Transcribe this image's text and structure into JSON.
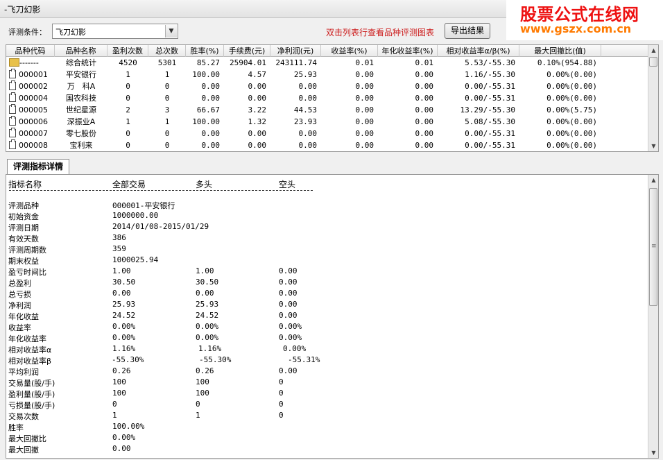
{
  "window": {
    "title": "-飞刀幻影"
  },
  "watermark": {
    "line1": "股票公式在线网",
    "line2": "www.gszx.com.cn"
  },
  "toolbar": {
    "condition_label": "评测条件：",
    "condition_value": "飞刀幻影",
    "hint": "双击列表行查看品种评测图表",
    "export_label": "导出结果"
  },
  "grid": {
    "columns": [
      "品种代码",
      "品种名称",
      "盈利次数",
      "总次数",
      "胜率(%)",
      "手续费(元)",
      "净利润(元)",
      "收益率(%)",
      "年化收益率(%)",
      "相对收益率α/β(%)",
      "最大回撤比(值)"
    ],
    "rows": [
      {
        "code": "-------",
        "name": "综合统计",
        "wins": "4520",
        "total": "5301",
        "winrate": "85.27",
        "fee": "25904.01",
        "profit": "243111.74",
        "ret": "0.01",
        "annual": "0.01",
        "ab": "5.53/-55.30",
        "dd": "0.10%(954.88)",
        "icon": "folder"
      },
      {
        "code": "000001",
        "name": "平安银行",
        "wins": "1",
        "total": "1",
        "winrate": "100.00",
        "fee": "4.57",
        "profit": "25.93",
        "ret": "0.00",
        "annual": "0.00",
        "ab": "1.16/-55.30",
        "dd": "0.00%(0.00)",
        "icon": "file"
      },
      {
        "code": "000002",
        "name": "万　科A",
        "wins": "0",
        "total": "0",
        "winrate": "0.00",
        "fee": "0.00",
        "profit": "0.00",
        "ret": "0.00",
        "annual": "0.00",
        "ab": "0.00/-55.31",
        "dd": "0.00%(0.00)",
        "icon": "file"
      },
      {
        "code": "000004",
        "name": "国农科技",
        "wins": "0",
        "total": "0",
        "winrate": "0.00",
        "fee": "0.00",
        "profit": "0.00",
        "ret": "0.00",
        "annual": "0.00",
        "ab": "0.00/-55.31",
        "dd": "0.00%(0.00)",
        "icon": "file"
      },
      {
        "code": "000005",
        "name": "世纪星源",
        "wins": "2",
        "total": "3",
        "winrate": "66.67",
        "fee": "3.22",
        "profit": "44.53",
        "ret": "0.00",
        "annual": "0.00",
        "ab": "13.29/-55.30",
        "dd": "0.00%(5.75)",
        "icon": "file"
      },
      {
        "code": "000006",
        "name": "深振业A",
        "wins": "1",
        "total": "1",
        "winrate": "100.00",
        "fee": "1.32",
        "profit": "23.93",
        "ret": "0.00",
        "annual": "0.00",
        "ab": "5.08/-55.30",
        "dd": "0.00%(0.00)",
        "icon": "file"
      },
      {
        "code": "000007",
        "name": "零七股份",
        "wins": "0",
        "total": "0",
        "winrate": "0.00",
        "fee": "0.00",
        "profit": "0.00",
        "ret": "0.00",
        "annual": "0.00",
        "ab": "0.00/-55.31",
        "dd": "0.00%(0.00)",
        "icon": "file"
      },
      {
        "code": "000008",
        "name": "宝利来",
        "wins": "0",
        "total": "0",
        "winrate": "0.00",
        "fee": "0.00",
        "profit": "0.00",
        "ret": "0.00",
        "annual": "0.00",
        "ab": "0.00/-55.31",
        "dd": "0.00%(0.00)",
        "icon": "file"
      }
    ]
  },
  "detail": {
    "tab_label": "评测指标详情",
    "headers": [
      "指标名称",
      "全部交易",
      "多头",
      "空头"
    ],
    "rows": [
      [
        "评测品种",
        "000001-平安银行",
        "",
        ""
      ],
      [
        "初始资金",
        "1000000.00",
        "",
        ""
      ],
      [
        "评测日期",
        "2014/01/08-2015/01/29",
        "",
        ""
      ],
      [
        "有效天数",
        "386",
        "",
        ""
      ],
      [
        "评测周期数",
        "359",
        "",
        ""
      ],
      [
        "期末权益",
        "1000025.94",
        "",
        ""
      ],
      [
        "盈亏时间比",
        "1.00",
        "1.00",
        "0.00"
      ],
      [
        "总盈利",
        "30.50",
        "30.50",
        "0.00"
      ],
      [
        "总亏损",
        "0.00",
        "0.00",
        "0.00"
      ],
      [
        "净利润",
        "25.93",
        "25.93",
        "0.00"
      ],
      [
        "年化收益",
        "24.52",
        "24.52",
        "0.00"
      ],
      [
        "收益率",
        "0.00%",
        "0.00%",
        "0.00%"
      ],
      [
        "年化收益率",
        "0.00%",
        "0.00%",
        "0.00%"
      ],
      [
        "相对收益率α",
        "1.16%",
        "1.16%",
        "0.00%"
      ],
      [
        "相对收益率β",
        "-55.30%",
        "-55.30%",
        "-55.31%"
      ],
      [
        "平均利润",
        "0.26",
        "0.26",
        "0.00"
      ],
      [
        "交易量(股/手)",
        "100",
        "100",
        "0"
      ],
      [
        "盈利量(股/手)",
        "100",
        "100",
        "0"
      ],
      [
        "亏损量(股/手)",
        "0",
        "0",
        "0"
      ],
      [
        "交易次数",
        "1",
        "1",
        "0"
      ],
      [
        "胜率",
        "100.00%",
        "",
        ""
      ],
      [
        "最大回撤比",
        "0.00%",
        "",
        ""
      ],
      [
        "最大回撤",
        "0.00",
        "",
        ""
      ]
    ]
  }
}
